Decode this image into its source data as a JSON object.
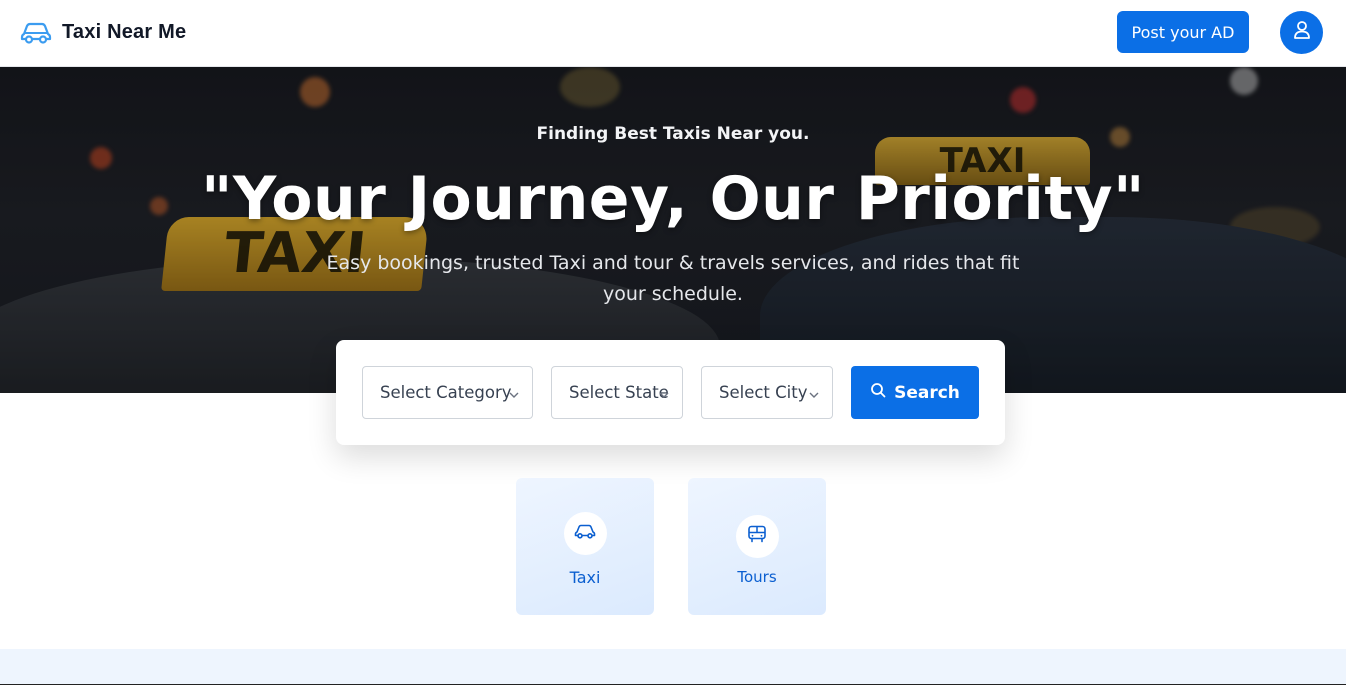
{
  "header": {
    "brand_name": "Taxi Near Me",
    "brand_icon": "car-icon",
    "post_ad_label": "Post your AD",
    "user_icon": "user-icon"
  },
  "hero": {
    "subtitle": "Finding Best Taxis Near you.",
    "title": "\"Your Journey, Our Priority\"",
    "description": "Easy bookings, trusted Taxi and tour & travels services, and rides that fit your schedule.",
    "sign_text": "TAXI"
  },
  "search": {
    "category_placeholder": "Select Category",
    "state_placeholder": "Select State",
    "city_placeholder": "Select City",
    "search_label": "Search",
    "search_icon": "search-icon"
  },
  "categories": [
    {
      "label": "Taxi",
      "icon": "car-icon"
    },
    {
      "label": "Tours",
      "icon": "bus-icon"
    }
  ],
  "colors": {
    "primary": "#0b6fe6",
    "tile_text": "#0b5fd0",
    "tile_bg": "#dbeafe"
  }
}
